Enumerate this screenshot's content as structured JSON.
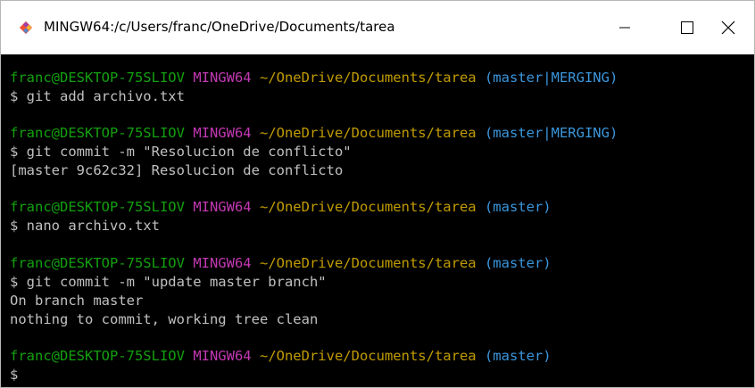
{
  "window": {
    "title": "MINGW64:/c/Users/franc/OneDrive/Documents/tarea",
    "controls": {
      "minimize": "minimize-icon",
      "maximize": "maximize-icon",
      "close": "close-icon"
    },
    "app_icon": "git-icon"
  },
  "colors": {
    "user_host": "#13a10e",
    "system": "#c239b3",
    "path": "#c19c00",
    "branch": "#3a96dd",
    "text": "#c0c0c0",
    "background": "#000000"
  },
  "terminal": {
    "blocks": [
      {
        "prompt": {
          "user": "franc@DESKTOP-75SLIOV",
          "system": "MINGW64",
          "path": "~/OneDrive/Documents/tarea",
          "branch": "(master|MERGING)"
        },
        "command": "$ git add archivo.txt",
        "output": []
      },
      {
        "prompt": {
          "user": "franc@DESKTOP-75SLIOV",
          "system": "MINGW64",
          "path": "~/OneDrive/Documents/tarea",
          "branch": "(master|MERGING)"
        },
        "command": "$ git commit -m \"Resolucion de conflicto\"",
        "output": [
          "[master 9c62c32] Resolucion de conflicto"
        ]
      },
      {
        "prompt": {
          "user": "franc@DESKTOP-75SLIOV",
          "system": "MINGW64",
          "path": "~/OneDrive/Documents/tarea",
          "branch": "(master)"
        },
        "command": "$ nano archivo.txt",
        "output": []
      },
      {
        "prompt": {
          "user": "franc@DESKTOP-75SLIOV",
          "system": "MINGW64",
          "path": "~/OneDrive/Documents/tarea",
          "branch": "(master)"
        },
        "command": "$ git commit -m \"update master branch\"",
        "output": [
          "On branch master",
          "nothing to commit, working tree clean"
        ]
      },
      {
        "prompt": {
          "user": "franc@DESKTOP-75SLIOV",
          "system": "MINGW64",
          "path": "~/OneDrive/Documents/tarea",
          "branch": "(master)"
        },
        "command": "$",
        "output": []
      }
    ]
  }
}
